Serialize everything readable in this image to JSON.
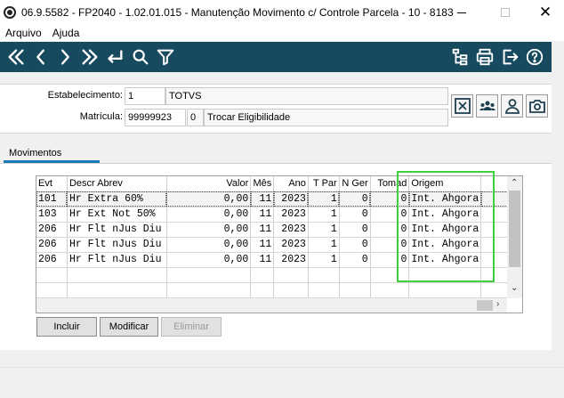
{
  "window": {
    "title": "06.9.5582 - FP2040 - 1.02.01.015 - Manutenção Movimento c/ Controle Parcela - 10 - 8183"
  },
  "menu": {
    "items": [
      "Arquivo",
      "Ajuda"
    ]
  },
  "toolbar": {
    "icons": [
      "first-icon",
      "previous-icon",
      "next-icon",
      "last-icon",
      "return-icon",
      "search-icon",
      "filter-icon",
      "hierarchy-icon",
      "print-icon",
      "exit-icon",
      "help-icon"
    ]
  },
  "header": {
    "estabelecimento_label": "Estabelecimento:",
    "estabelecimento_code": "1",
    "estabelecimento_name": "TOTVS",
    "matricula_label": "Matrícula:",
    "matricula_code": "99999923",
    "matricula_digit": "0",
    "matricula_name": "Trocar Eligibilidade"
  },
  "tabs": [
    {
      "label": "Movimentos"
    }
  ],
  "grid": {
    "columns": [
      "Evt",
      "Descr Abrev",
      "Valor",
      "Mês",
      "Ano",
      "T Par",
      "N Ger",
      "Tomad",
      "Origem"
    ],
    "rows": [
      [
        "101",
        "Hr Extra 60%",
        "0,00",
        "11",
        "2023",
        "1",
        "0",
        "0",
        "Int. Ahgora"
      ],
      [
        "103",
        "Hr Ext Not  50%",
        "0,00",
        "11",
        "2023",
        "1",
        "0",
        "0",
        "Int. Ahgora"
      ],
      [
        "206",
        "Hr Flt nJus Diu",
        "0,00",
        "11",
        "2023",
        "1",
        "0",
        "0",
        "Int. Ahgora"
      ],
      [
        "206",
        "Hr Flt nJus Diu",
        "0,00",
        "11",
        "2023",
        "1",
        "0",
        "0",
        "Int. Ahgora"
      ],
      [
        "206",
        "Hr Flt nJus Diu",
        "0,00",
        "11",
        "2023",
        "1",
        "0",
        "0",
        "Int. Ahgora"
      ]
    ]
  },
  "buttons": {
    "incluir": "Incluir",
    "modificar": "Modificar",
    "eliminar": "Eliminar"
  },
  "colors": {
    "toolbar_bg": "#174a5f",
    "tab_underline": "#1a7ab8",
    "highlight_box": "#3fd03f"
  }
}
